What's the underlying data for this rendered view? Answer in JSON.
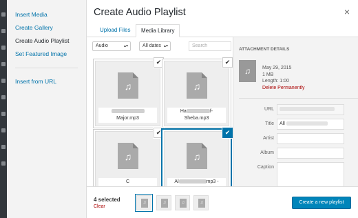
{
  "sidebar": {
    "items": [
      {
        "label": "Insert Media"
      },
      {
        "label": "Create Gallery"
      },
      {
        "label": "Create Audio Playlist"
      },
      {
        "label": "Set Featured Image"
      }
    ],
    "url_item": "Insert from URL"
  },
  "header": {
    "title": "Create Audio Playlist",
    "close": "×"
  },
  "tabs": {
    "upload": "Upload Files",
    "library": "Media Library"
  },
  "toolbar": {
    "type_filter": "Audio",
    "date_filter": "All dates",
    "search_placeholder": "Search"
  },
  "grid": {
    "items": [
      {
        "name_line2": "Major.mp3",
        "check": "✔"
      },
      {
        "name_line1": "Ha",
        "name_line1b": "f-",
        "name_line2": "Sheba.mp3",
        "check": "✔"
      },
      {
        "name_line1": "C",
        "check": "✔"
      },
      {
        "name_line1": "Al",
        "name_line1b": "mp3 -",
        "check": "✔"
      }
    ],
    "icon": "♫"
  },
  "details": {
    "heading": "ATTACHMENT DETAILS",
    "date": "May 29, 2015",
    "size": "1 MB",
    "length": "Length: 1:00",
    "delete": "Delete Permanently",
    "fields": {
      "url_label": "URL",
      "title_label": "Title",
      "title_value": "All",
      "artist_label": "Artist",
      "album_label": "Album",
      "caption_label": "Caption"
    }
  },
  "bottom": {
    "count": "4 selected",
    "clear": "Clear",
    "button": "Create a new playlist"
  },
  "colors": {
    "accent": "#0073aa",
    "primary": "#0085ba",
    "danger": "#a00000"
  }
}
